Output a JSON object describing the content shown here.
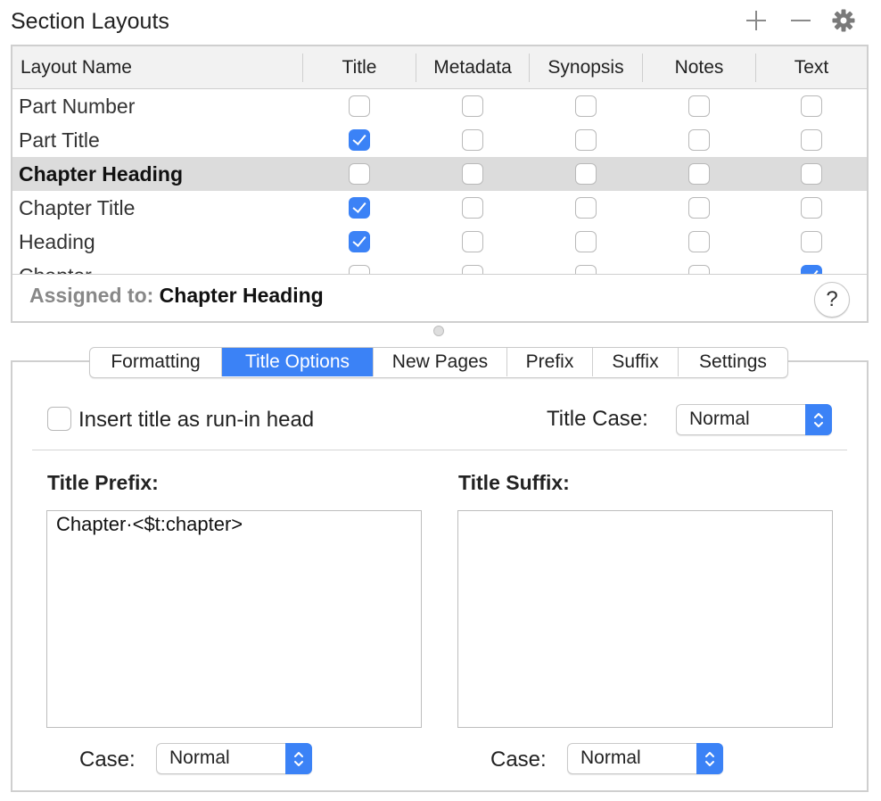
{
  "header": {
    "title": "Section Layouts"
  },
  "table": {
    "columns": [
      "Layout Name",
      "Title",
      "Metadata",
      "Synopsis",
      "Notes",
      "Text"
    ],
    "rows": [
      {
        "name": "Part Number",
        "checks": [
          false,
          false,
          false,
          false,
          false
        ],
        "selected": false
      },
      {
        "name": "Part Title",
        "checks": [
          true,
          false,
          false,
          false,
          false
        ],
        "selected": false
      },
      {
        "name": "Chapter Heading",
        "checks": [
          false,
          false,
          false,
          false,
          false
        ],
        "selected": true
      },
      {
        "name": "Chapter Title",
        "checks": [
          true,
          false,
          false,
          false,
          false
        ],
        "selected": false
      },
      {
        "name": "Heading",
        "checks": [
          true,
          false,
          false,
          false,
          false
        ],
        "selected": false
      },
      {
        "name": "Chapter",
        "checks": [
          false,
          false,
          false,
          false,
          true
        ],
        "selected": false
      }
    ]
  },
  "assigned": {
    "label": "Assigned to:",
    "value": "Chapter Heading"
  },
  "help_label": "?",
  "tabs": [
    {
      "label": "Formatting",
      "active": false
    },
    {
      "label": "Title Options",
      "active": true
    },
    {
      "label": "New Pages",
      "active": false
    },
    {
      "label": "Prefix",
      "active": false
    },
    {
      "label": "Suffix",
      "active": false
    },
    {
      "label": "Settings",
      "active": false
    }
  ],
  "options": {
    "runin_label": "Insert title as run-in head",
    "runin_checked": false,
    "title_case_label": "Title Case:",
    "title_case_value": "Normal"
  },
  "prefix": {
    "label": "Title Prefix:",
    "value": "Chapter·<$t:chapter>",
    "case_label": "Case:",
    "case_value": "Normal"
  },
  "suffix": {
    "label": "Title Suffix:",
    "value": "",
    "case_label": "Case:",
    "case_value": "Normal"
  },
  "colors": {
    "accent": "#3b82f6",
    "selected_row": "#dcdcdc",
    "border": "#cfcfcf"
  }
}
